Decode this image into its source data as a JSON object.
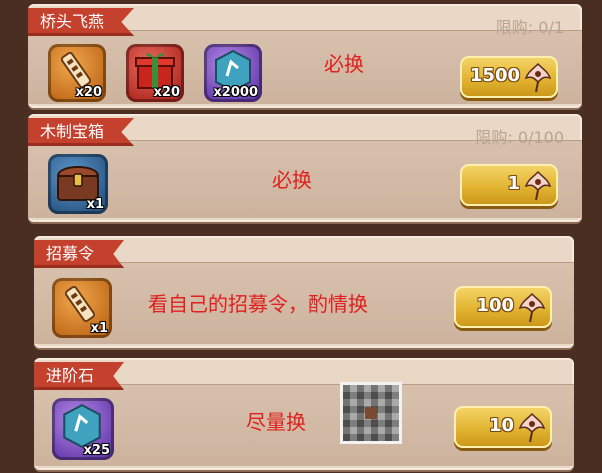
{
  "sections": [
    {
      "title": "桥头飞燕",
      "limit": "限购: 0/1",
      "items": [
        {
          "icon": "token-icon",
          "qty": "x20"
        },
        {
          "icon": "gift-box-icon",
          "qty": "x20"
        },
        {
          "icon": "advance-stone-icon",
          "qty": "x2000"
        }
      ],
      "price": "1500",
      "note": "必换"
    },
    {
      "title": "木制宝箱",
      "limit": "限购: 0/100",
      "items": [
        {
          "icon": "wooden-chest-icon",
          "qty": "x1"
        }
      ],
      "price": "1",
      "note": "必换"
    },
    {
      "title": "招募令",
      "limit": "",
      "items": [
        {
          "icon": "token-icon",
          "qty": "x1"
        }
      ],
      "price": "100",
      "note": "看自己的招募令，酌情换"
    },
    {
      "title": "进阶石",
      "limit": "",
      "items": [
        {
          "icon": "advance-stone-icon",
          "qty": "x25"
        }
      ],
      "price": "10",
      "note": "尽量换"
    }
  ],
  "currency_icon": "flower-currency-icon",
  "colors": {
    "ribbon": "#c4412d",
    "note": "#e0201c",
    "button": "#e2b432",
    "panel": "#e9d8c6"
  }
}
